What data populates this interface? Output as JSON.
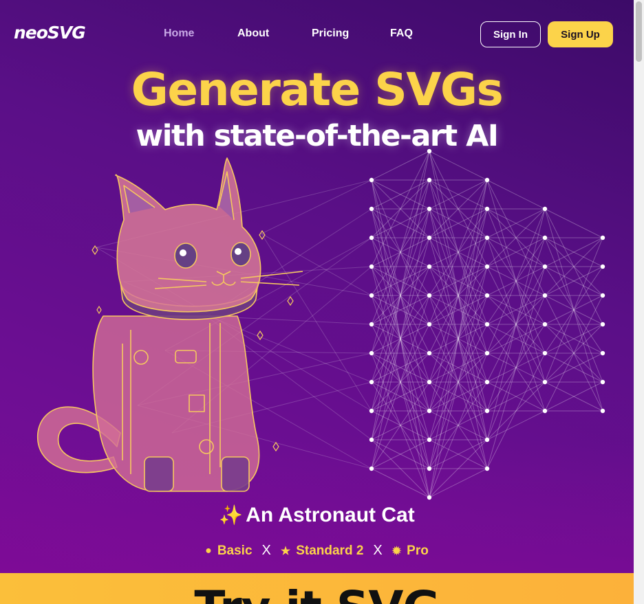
{
  "nav": {
    "logo": "neoSVG",
    "links": [
      {
        "label": "Home",
        "active": true
      },
      {
        "label": "About"
      },
      {
        "label": "Pricing"
      },
      {
        "label": "FAQ"
      }
    ],
    "signin_label": "Sign In",
    "signup_label": "Sign Up"
  },
  "hero": {
    "title": "Generate SVGs",
    "subtitle": "with state-of-the-art AI",
    "caption_icon": "sparkles-icon",
    "caption": "An Astronaut Cat",
    "tiers": [
      {
        "icon": "dot-icon",
        "glyph": "●",
        "label": "Basic"
      },
      {
        "icon": "star-icon",
        "glyph": "★",
        "label": "Standard 2"
      },
      {
        "icon": "sun-icon",
        "glyph": "✹",
        "label": "Pro"
      }
    ],
    "tier_separator": "X"
  },
  "cta": {
    "title": "Try it SVG"
  },
  "colors": {
    "accent": "#fcd34a",
    "hero_dark": "#3c0b68",
    "hero_light": "#790c96",
    "cta_bg": "#fbbf3a"
  }
}
